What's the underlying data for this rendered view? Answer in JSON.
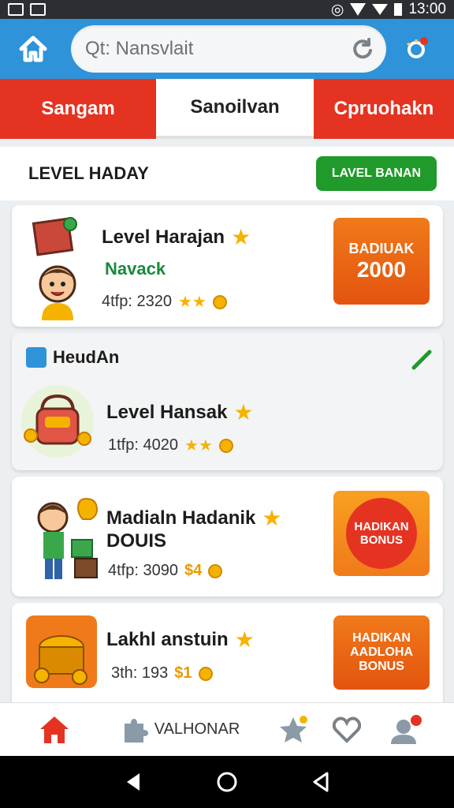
{
  "status_bar": {
    "time": "13:00"
  },
  "header": {
    "search": {
      "value": "Qt: Nansvlait"
    }
  },
  "tabs": [
    {
      "label": "Sangam"
    },
    {
      "label": "Sanoilvan"
    },
    {
      "label": "Cpruohakn"
    }
  ],
  "section": {
    "title": "LEVEL HADAY",
    "action_label": "LAVEL BANAN"
  },
  "cards": [
    {
      "title": "Level Harajan",
      "subtitle": "Navack",
      "meta": "4tfp: 2320",
      "stars": "★★",
      "badge_line1": "BADIUAK",
      "badge_line2": "2000"
    },
    {
      "group_label": "HeudAn",
      "title": "Level Hansak",
      "meta": "1tfp: 4020",
      "stars": "★★"
    },
    {
      "title": "Madialn Hadanik",
      "title2": "DOUIS",
      "meta": "4tfp: 3090",
      "price": "$4",
      "badge_line1": "HADIKAN",
      "badge_line2": "BONUS"
    },
    {
      "title": "Lakhl anstuin",
      "meta": "3th: 193",
      "price": "$1",
      "badge_line1": "HADIKAN",
      "badge_line2": "AADLOHA",
      "badge_line3": "BONUS"
    }
  ],
  "bottom_nav": {
    "center_label": "VALHONAR"
  },
  "colors": {
    "primary_blue": "#2e93d8",
    "tab_red": "#e53321",
    "action_green": "#1f9a2b",
    "badge_orange": "#e3540f",
    "star_yellow": "#f5b300"
  }
}
